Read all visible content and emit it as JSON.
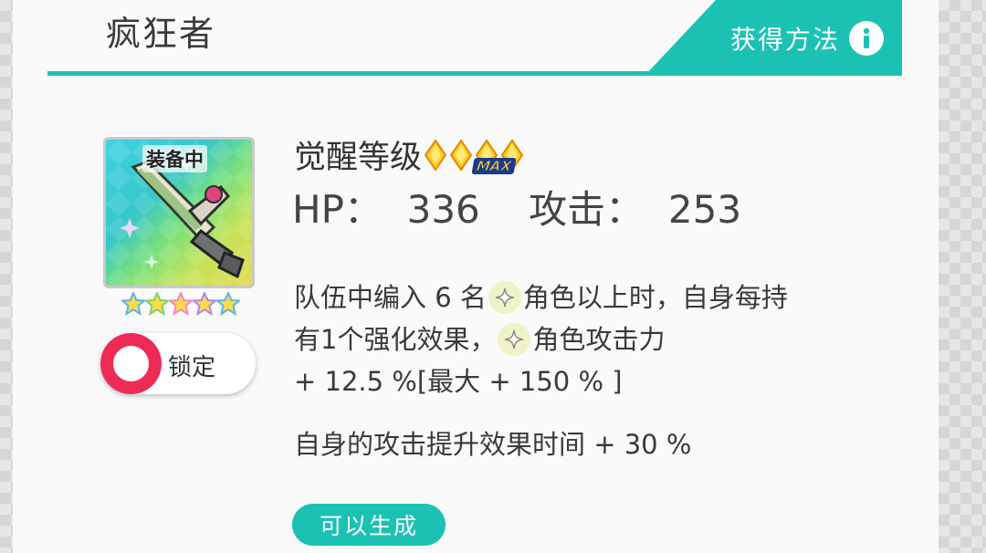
{
  "item": {
    "name": "疯狂者"
  },
  "header": {
    "obtain_label": "获得方法"
  },
  "card": {
    "equipped_label": "装备中",
    "star_count": 5,
    "lock_label": "锁定"
  },
  "awaken": {
    "label": "觉醒等级",
    "max_badge": "MAX",
    "level": 4,
    "max_level": 4
  },
  "stats": {
    "line": "HP：  336    攻击：  253"
  },
  "description": {
    "line1_a": "队伍中编入 6 名",
    "line1_b": "角色以上时，自身每持",
    "line2_a": "有1个强化效果，",
    "line2_b": "角色攻击力",
    "line3": "+ 12.5 %[最大 + 150 % ]",
    "line4": "自身的攻击提升效果时间 + 30 %"
  },
  "actions": {
    "generate_label": "可以生成"
  },
  "colors": {
    "accent": "#1bc2b3",
    "lock": "#ee2a57"
  }
}
